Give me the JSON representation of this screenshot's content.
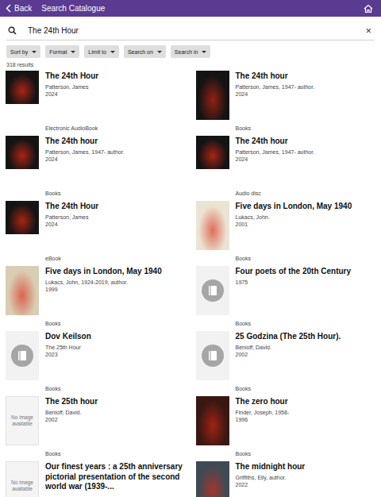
{
  "header": {
    "back": "Back",
    "title": "Search Catalogue"
  },
  "search": {
    "value": "The 24th Hour",
    "clear": "×"
  },
  "filters": [
    "Sort by",
    "Format",
    "Limit to",
    "Search on",
    "Search in"
  ],
  "result_count": "318 results",
  "results": [
    {
      "title": "The 24th Hour",
      "author": "Patterson, James",
      "year": "2024",
      "format": "Electronic AudioBook",
      "cover": {
        "kind": "cover-square",
        "color": "#141414"
      }
    },
    {
      "title": "The 24th hour",
      "author": "Patterson, James, 1947- author.",
      "year": "2024",
      "format": "Books",
      "cover": {
        "kind": "cover-tall",
        "color": "#141414"
      }
    },
    {
      "title": "The 24th hour",
      "author": "Patterson, James, 1947- author.",
      "year": "2024",
      "format": "Books",
      "cover": {
        "kind": "cover-square",
        "color": "#141414"
      }
    },
    {
      "title": "The 24th hour",
      "author": "Patterson, James, 1947- author.",
      "year": "2024",
      "format": "Audio disc",
      "cover": {
        "kind": "cover-square",
        "color": "#141414"
      }
    },
    {
      "title": "The 24th Hour",
      "author": "Patterson, James",
      "year": "2024",
      "format": "eBook",
      "cover": {
        "kind": "cover-square",
        "color": "#141414"
      }
    },
    {
      "title": "Five days in London, May 1940",
      "author": "Lukacs, John.",
      "year": "2001",
      "format": "Books",
      "cover": {
        "kind": "cover-tall",
        "color": "#ebe4d3"
      }
    },
    {
      "title": "Five days in London, May 1940",
      "author": "Lukacs, John, 1924-2019, author.",
      "year": "1999",
      "format": "Books",
      "cover": {
        "kind": "cover-tall",
        "color": "#d9cdb4"
      }
    },
    {
      "title": "Four poets of the 20th Century",
      "author": "",
      "year": "1975",
      "format": "Books",
      "cover": {
        "kind": "placeholder",
        "color": "#f2f2f2"
      }
    },
    {
      "title": "Dov Keilson",
      "author": "The 25th Hour",
      "year": "2023",
      "format": "Books",
      "cover": {
        "kind": "placeholder",
        "color": "#f2f2f2"
      }
    },
    {
      "title": "25 Godzina (The 25th Hour).",
      "author": "Benioff, David.",
      "year": "2002",
      "format": "Books",
      "cover": {
        "kind": "placeholder",
        "color": "#f2f2f2"
      }
    },
    {
      "title": "The 25th hour",
      "author": "Benioff, David.",
      "year": "2002",
      "format": "Books",
      "cover": {
        "kind": "no-image",
        "color": "#f4f4f4",
        "text": "No image available"
      }
    },
    {
      "title": "The zero hour",
      "author": "Finder, Joseph, 1958-",
      "year": "1996",
      "format": "Books",
      "cover": {
        "kind": "cover-tall",
        "color": "#3a1812"
      }
    },
    {
      "title": "Our finest years : a 25th anniversary pictorial presentation of the second world war (1939-...",
      "author": "",
      "year": "",
      "format": "",
      "cover": {
        "kind": "no-image",
        "color": "#f4f4f4",
        "text": "No image available"
      }
    },
    {
      "title": "The midnight hour",
      "author": "Griffiths, Elly, author.",
      "year": "2022",
      "format": "",
      "cover": {
        "kind": "cover-tall",
        "color": "#3f4a55"
      }
    }
  ]
}
